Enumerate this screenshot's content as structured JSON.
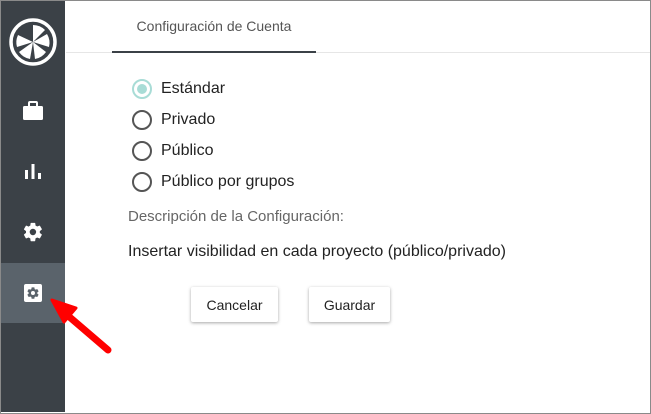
{
  "sidebar": {
    "items": [
      {
        "icon": "briefcase-icon"
      },
      {
        "icon": "bar-chart-icon"
      },
      {
        "icon": "gear-icon"
      },
      {
        "icon": "settings-box-icon",
        "active": true
      }
    ]
  },
  "tabs": [
    {
      "label": "Configuración de Cuenta",
      "active": true
    }
  ],
  "visibility": {
    "selected": "Estándar",
    "options": [
      {
        "label": "Estándar",
        "checked": true
      },
      {
        "label": "Privado",
        "checked": false
      },
      {
        "label": "Público",
        "checked": false
      },
      {
        "label": "Público por grupos",
        "checked": false
      }
    ]
  },
  "description": {
    "label": "Descripción de la Configuración:",
    "text": "Insertar visibilidad en cada proyecto (público/privado)"
  },
  "actions": {
    "cancel_label": "Cancelar",
    "save_label": "Guardar"
  },
  "colors": {
    "sidebar_bg": "#3b4147",
    "sidebar_active": "#5a636b",
    "radio_checked": "#a8dcd6",
    "annotation_arrow": "#ff0000"
  }
}
